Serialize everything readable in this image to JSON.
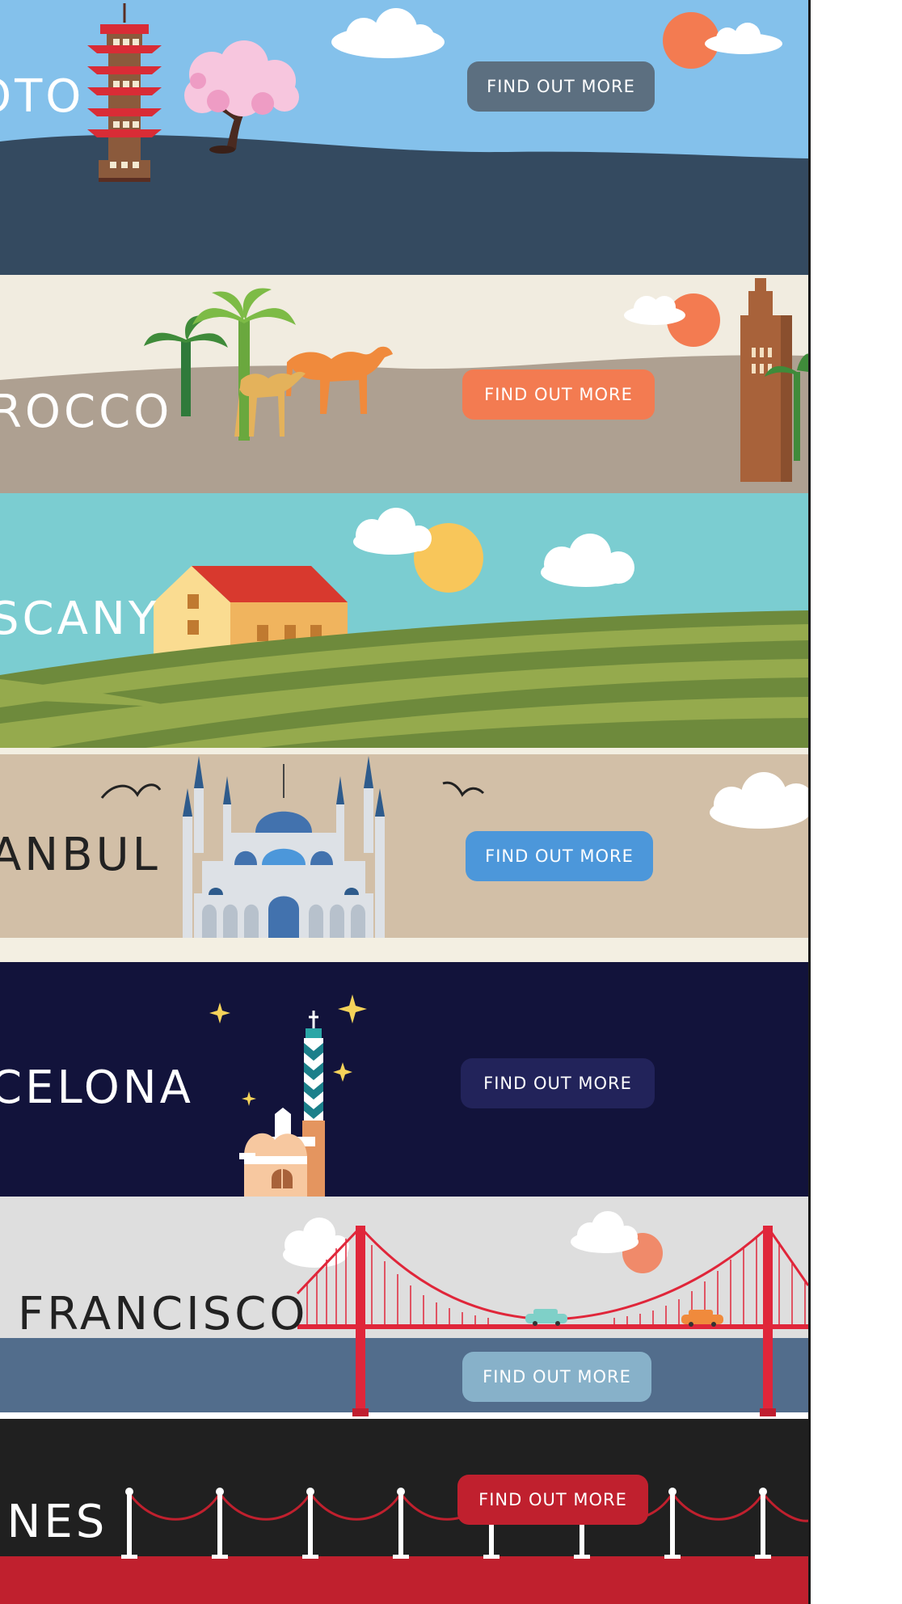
{
  "destinations": [
    {
      "name": "OTO",
      "cta": "FIND OUT MORE",
      "sky": "#84c1eb",
      "ground": "#344a60",
      "button_color": "#5c6f80",
      "text_color": "#ffffff"
    },
    {
      "name": "ROCCO",
      "cta": "FIND OUT MORE",
      "sky": "#f1ece0",
      "ground": "#aea091",
      "button_color": "#f37b51",
      "text_color": "#ffffff"
    },
    {
      "name": "SCANY",
      "cta": "",
      "sky": "#7bcdd1",
      "ground": "#95aa4d",
      "text_color": "#ffffff"
    },
    {
      "name": "ANBUL",
      "cta": "FIND OUT MORE",
      "sky": "#d2bfa7",
      "ground": "#f3efe2",
      "button_color": "#4c97da",
      "text_color": "#222222"
    },
    {
      "name": "CELONA",
      "cta": "FIND OUT MORE",
      "sky": "#12133b",
      "button_color": "#22235a",
      "text_color": "#ffffff"
    },
    {
      "name": "FRANCISCO",
      "cta": "FIND OUT MORE",
      "sky": "#dedede",
      "ground": "#526d8c",
      "button_color": "#87b1c9",
      "text_color": "#222222"
    },
    {
      "name": "INES",
      "cta": "FIND OUT MORE",
      "sky": "#202020",
      "ground": "#c0202e",
      "button_color": "#c0202e",
      "text_color": "#ffffff"
    }
  ]
}
